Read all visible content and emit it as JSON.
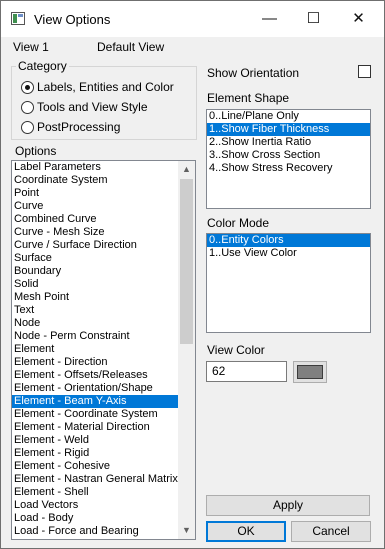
{
  "window": {
    "title": "View Options"
  },
  "titlebar": {
    "minimize": "—",
    "maximize": "☐",
    "close": "✕"
  },
  "view_info": {
    "view_label": "View  1",
    "view_name": "Default View"
  },
  "category": {
    "legend": "Category",
    "options": [
      {
        "label": "Labels, Entities and Color",
        "selected": true
      },
      {
        "label": "Tools and View Style",
        "selected": false
      },
      {
        "label": "PostProcessing",
        "selected": false
      }
    ]
  },
  "options": {
    "legend": "Options",
    "selected_index": 18,
    "items": [
      "Label Parameters",
      "Coordinate System",
      "Point",
      "Curve",
      "Combined Curve",
      "Curve - Mesh Size",
      "Curve / Surface Direction",
      "Surface",
      "Boundary",
      "Solid",
      "Mesh Point",
      "Text",
      "Node",
      "Node - Perm Constraint",
      "Element",
      "Element - Direction",
      "Element - Offsets/Releases",
      "Element - Orientation/Shape",
      "Element - Beam Y-Axis",
      "Element - Coordinate System",
      "Element - Material Direction",
      "Element - Weld",
      "Element - Rigid",
      "Element - Cohesive",
      "Element - Nastran General Matrix",
      "Element - Shell",
      "Load Vectors",
      "Load - Body",
      "Load - Force and Bearing"
    ]
  },
  "show_orientation": {
    "label": "Show Orientation",
    "checked": false
  },
  "element_shape": {
    "label": "Element Shape",
    "selected_index": 1,
    "items": [
      "0..Line/Plane Only",
      "1..Show Fiber Thickness",
      "2..Show Inertia Ratio",
      "3..Show Cross Section",
      "4..Show Stress Recovery"
    ]
  },
  "color_mode": {
    "label": "Color Mode",
    "selected_index": 0,
    "items": [
      "0..Entity Colors",
      "1..Use View Color"
    ]
  },
  "view_color": {
    "label": "View Color",
    "value": "62",
    "swatch_color": "#808080"
  },
  "buttons": {
    "apply": "Apply",
    "ok": "OK",
    "cancel": "Cancel"
  },
  "colors": {
    "selection": "#0078d7",
    "window_bg": "#f0f0f0"
  }
}
